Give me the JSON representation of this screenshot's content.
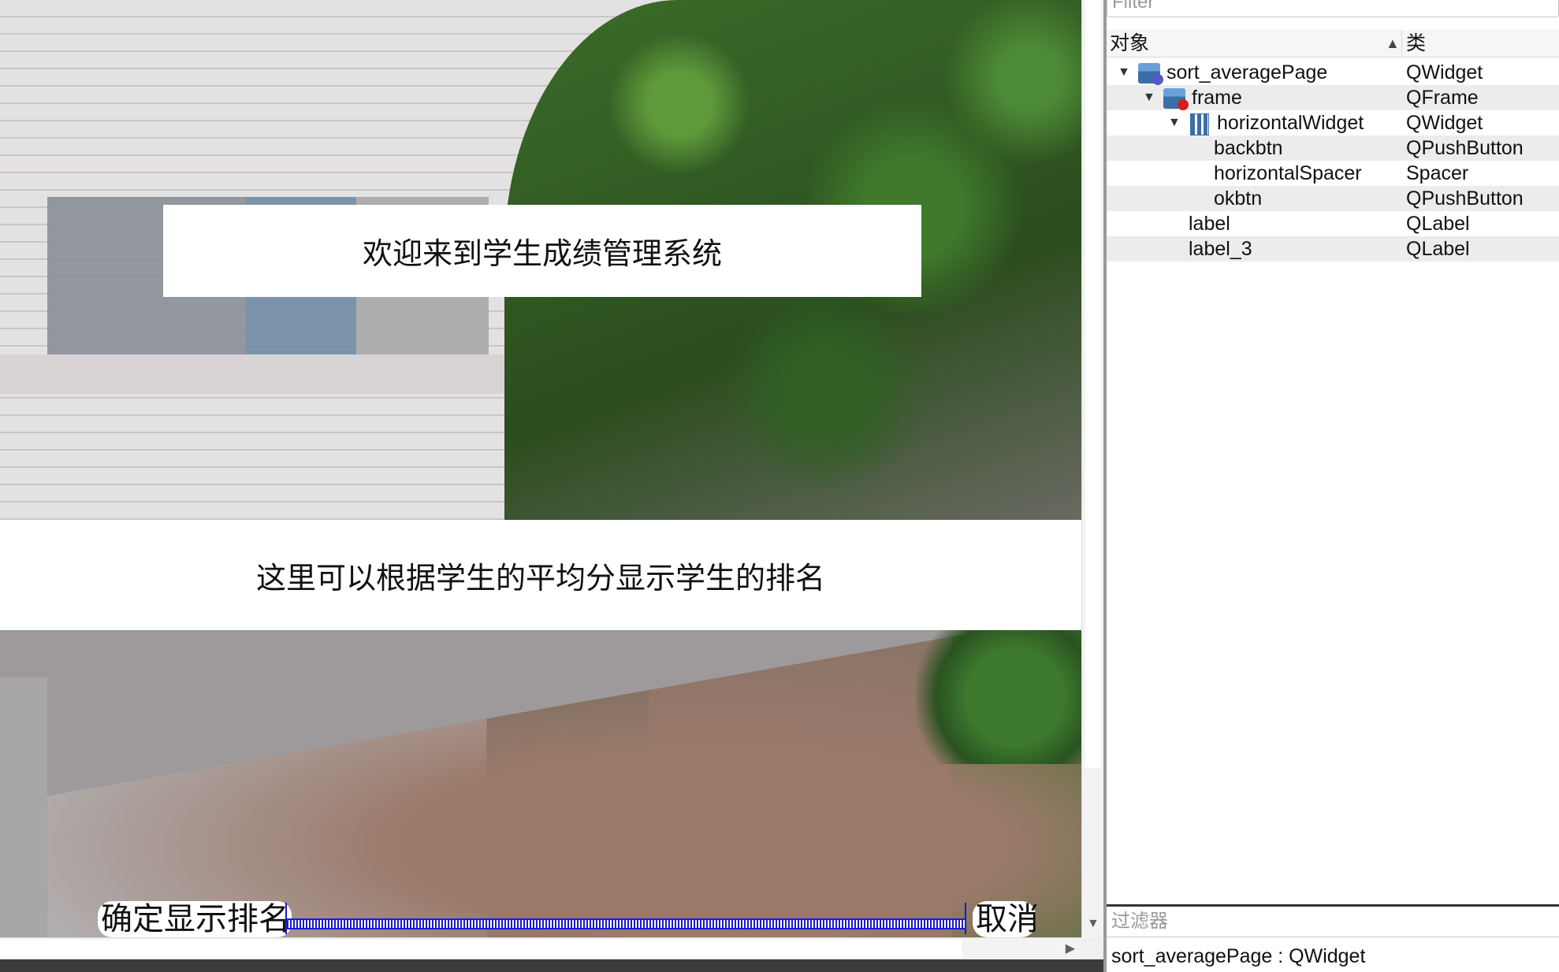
{
  "canvas": {
    "welcome_label": "欢迎来到学生成绩管理系统",
    "description_label": "这里可以根据学生的平均分显示学生的排名",
    "ok_button": "确定显示排名",
    "back_button": "取消"
  },
  "inspector": {
    "filter_placeholder": "Filter",
    "headers": {
      "object": "对象",
      "class": "类"
    },
    "rows": [
      {
        "name": "sort_averagePage",
        "class": "QWidget"
      },
      {
        "name": "frame",
        "class": "QFrame"
      },
      {
        "name": "horizontalWidget",
        "class": "QWidget"
      },
      {
        "name": "backbtn",
        "class": "QPushButton"
      },
      {
        "name": "horizontalSpacer",
        "class": "Spacer"
      },
      {
        "name": "okbtn",
        "class": "QPushButton"
      },
      {
        "name": "label",
        "class": "QLabel"
      },
      {
        "name": "label_3",
        "class": "QLabel"
      }
    ],
    "filter_bottom_placeholder": "过滤器",
    "status": "sort_averagePage : QWidget"
  },
  "icons": {
    "expand": "triangle-down-icon",
    "sort": "triangle-up-icon",
    "scroll_down": "arrow-down-icon",
    "scroll_right": "arrow-right-icon"
  }
}
